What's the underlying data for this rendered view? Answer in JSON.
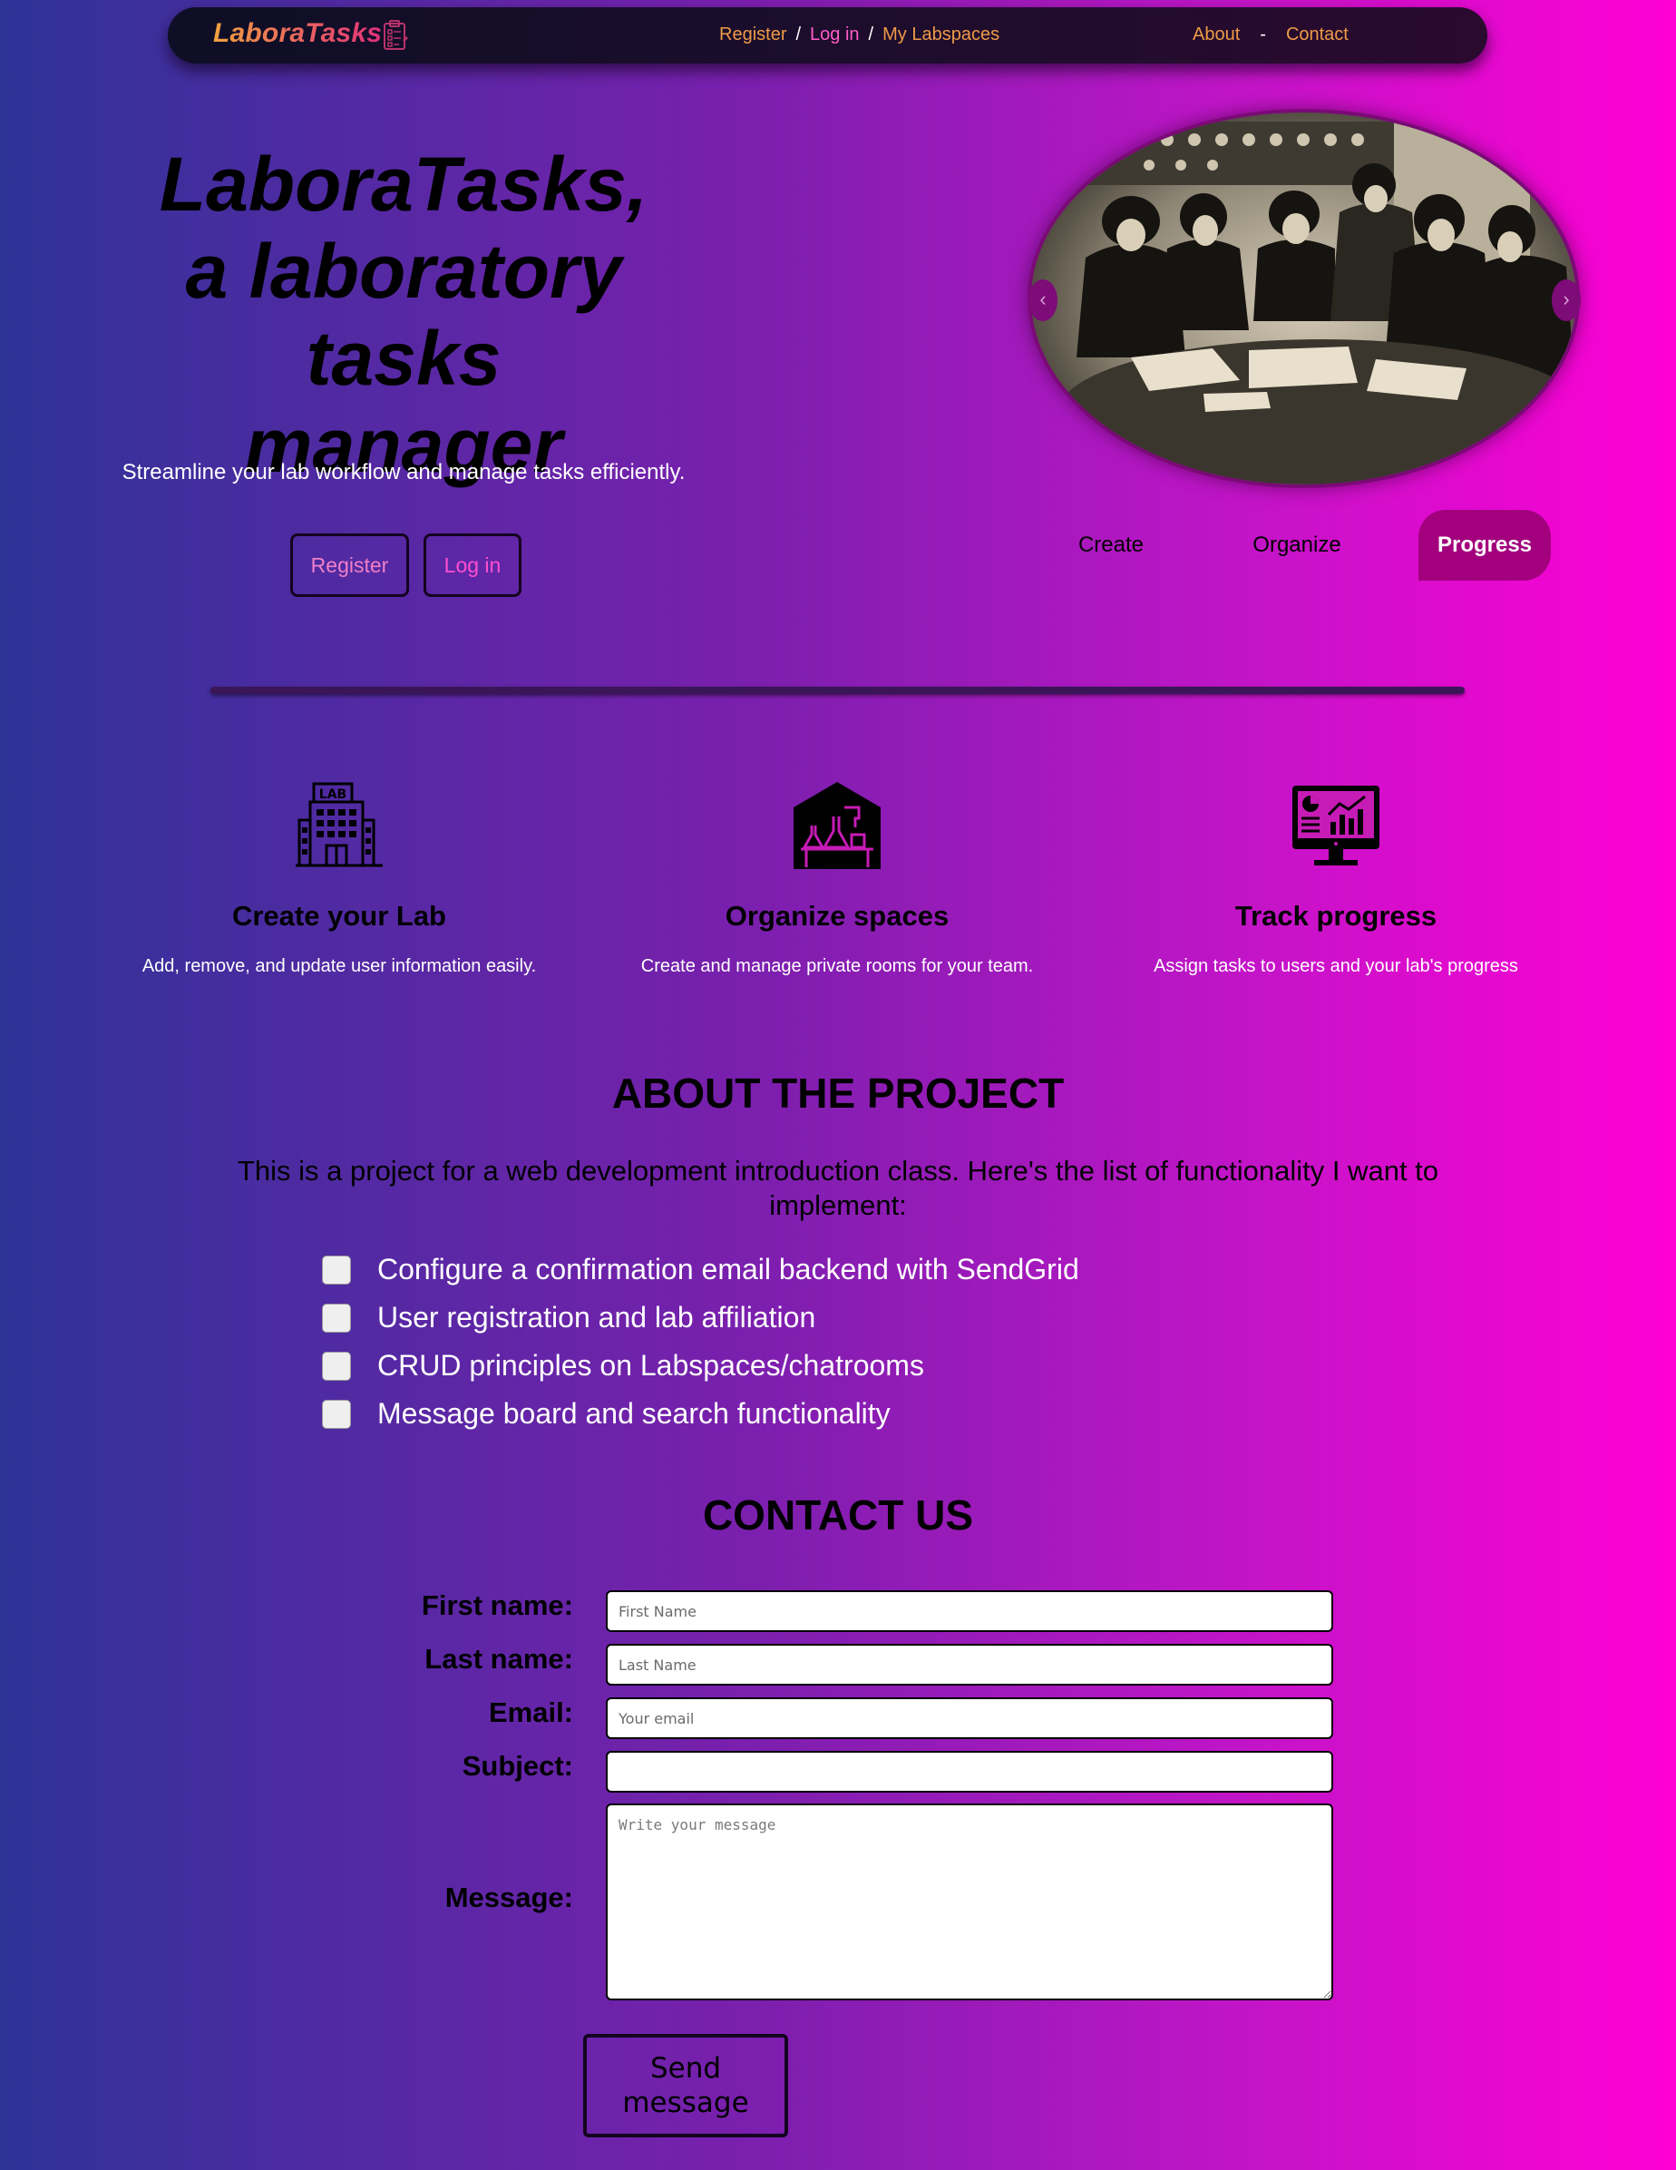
{
  "nav": {
    "brand": "LaboraTasks",
    "brand_icon": "clipboard-checklist-icon",
    "links": {
      "register": "Register",
      "login": "Log in",
      "labspaces": "My Labspaces",
      "about": "About",
      "contact": "Contact"
    },
    "separator_slash": "/",
    "separator_dash": "-"
  },
  "hero": {
    "title": "LaboraTasks,\na laboratory tasks\nmanager",
    "subtitle": "Streamline your lab workflow and manage tasks efficiently.",
    "register_button": "Register",
    "login_button": "Log in",
    "carousel": {
      "prev_glyph": "‹",
      "next_glyph": "›",
      "tabs": [
        "Create",
        "Organize",
        "Progress"
      ],
      "active_tab": "Progress"
    }
  },
  "features": [
    {
      "icon": "lab-building-icon",
      "title": "Create your Lab",
      "text": "Add, remove, and update user information easily."
    },
    {
      "icon": "lab-room-flasks-icon",
      "title": "Organize spaces",
      "text": "Create and manage private rooms for your team."
    },
    {
      "icon": "monitor-chart-icon",
      "title": "Track progress",
      "text": "Assign tasks to users and your lab's progress"
    }
  ],
  "about": {
    "title": "ABOUT THE PROJECT",
    "text": "This is a project for a web development introduction class. Here's the list of functionality I want to implement:",
    "items": [
      "Configure a confirmation email backend with SendGrid",
      "User registration and lab affiliation",
      "CRUD principles on Labspaces/chatrooms",
      "Message board and search functionality"
    ]
  },
  "contact": {
    "title": "CONTACT US",
    "first_name_label": "First name:",
    "first_name_placeholder": "First Name",
    "last_name_label": "Last name:",
    "last_name_placeholder": "Last Name",
    "email_label": "Email:",
    "email_placeholder": "Your email",
    "subject_label": "Subject:",
    "subject_placeholder": "",
    "message_label": "Message:",
    "message_placeholder": "Write your message",
    "send_button": "Send message"
  },
  "colors": {
    "gradient_start": "#2e3398",
    "gradient_mid": "#7b1fae",
    "gradient_end": "#ff00d4",
    "brand_orange": "#f2a040",
    "link_orange": "#ee9a47",
    "link_pink": "#ff5cc8",
    "active_tab": "#a3007e"
  }
}
